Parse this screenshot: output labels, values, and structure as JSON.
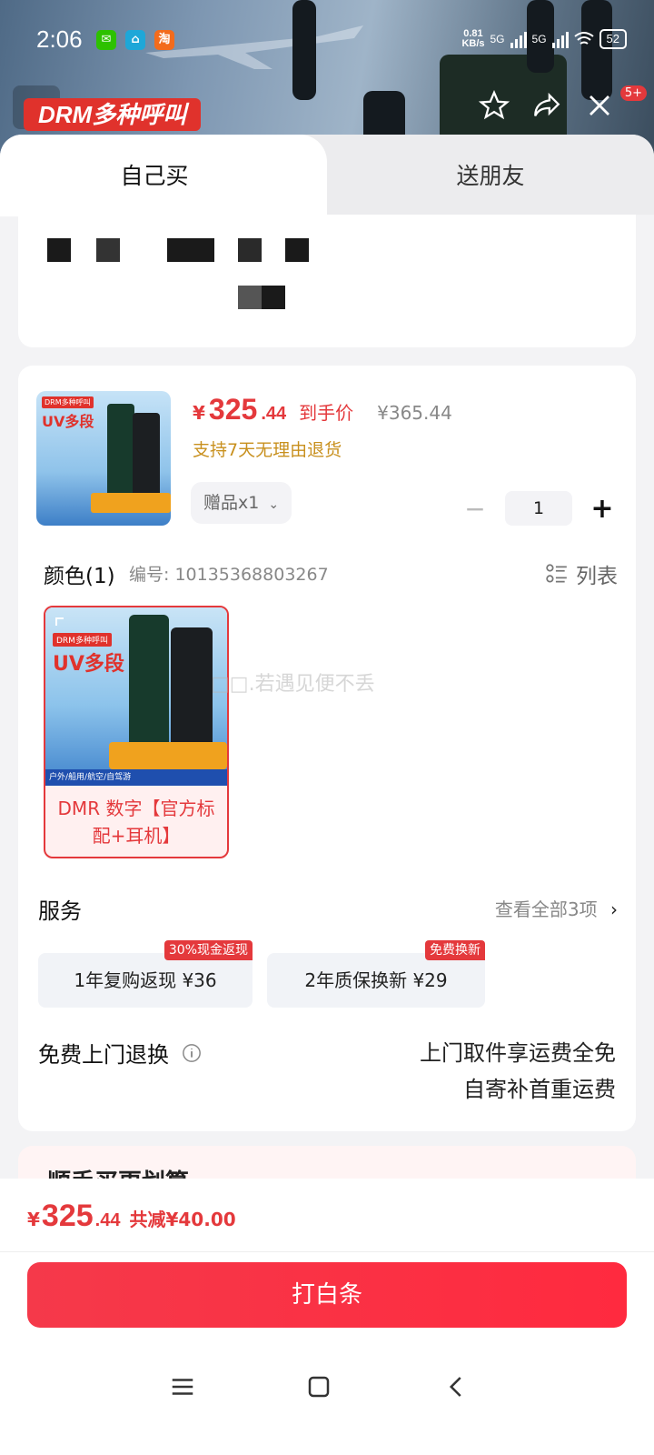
{
  "status_bar": {
    "time": "2:06",
    "net_speed_value": "0.81",
    "net_speed_unit": "KB/s",
    "signal_1": "5G",
    "signal_2": "5G",
    "battery": "52"
  },
  "header": {
    "banner_tag": "DRM多种呼叫",
    "cart_badge": "5+"
  },
  "tabs": {
    "self": "自己买",
    "friend": "送朋友"
  },
  "product": {
    "thumb_top_tag": "DRM多种呼叫",
    "thumb_title": "UV多段",
    "price_symbol": "¥",
    "price_int": "325",
    "price_dec": ".44",
    "price_label": "到手价",
    "original_price": "¥365.44",
    "return_policy": "支持7天无理由退货",
    "gift": "赠品x1",
    "quantity": "1"
  },
  "color": {
    "title": "颜色(1)",
    "code": "编号: 10135368803267",
    "list_label": "列表",
    "sku_label": "DMR 数字【官方标配+耳机】",
    "sku_bottom_text": "户外/船用/航空/自驾游"
  },
  "watermark": "□□.若遇见便不丢",
  "services": {
    "title": "服务",
    "view_all": "查看全部3项",
    "chips": [
      {
        "label": "1年复购返现  ¥36",
        "badge": "30%现金返现"
      },
      {
        "label": "2年质保换新  ¥29",
        "badge": "免费换新"
      }
    ]
  },
  "return_service": {
    "title": "免费上门退换",
    "line1": "上门取件享运费全免",
    "line2": "自寄补首重运费"
  },
  "peek": {
    "text": "顺手买更划算"
  },
  "bottom": {
    "price_symbol": "¥",
    "price_int": "325",
    "price_dec": ".44",
    "saving": "共减¥40.00",
    "pay_button": "打白条"
  },
  "colors": {
    "accent": "#e4393c",
    "gold": "#c8901e",
    "pay_gradient_start": "#f5394a",
    "pay_gradient_end": "#ff2a3f"
  }
}
